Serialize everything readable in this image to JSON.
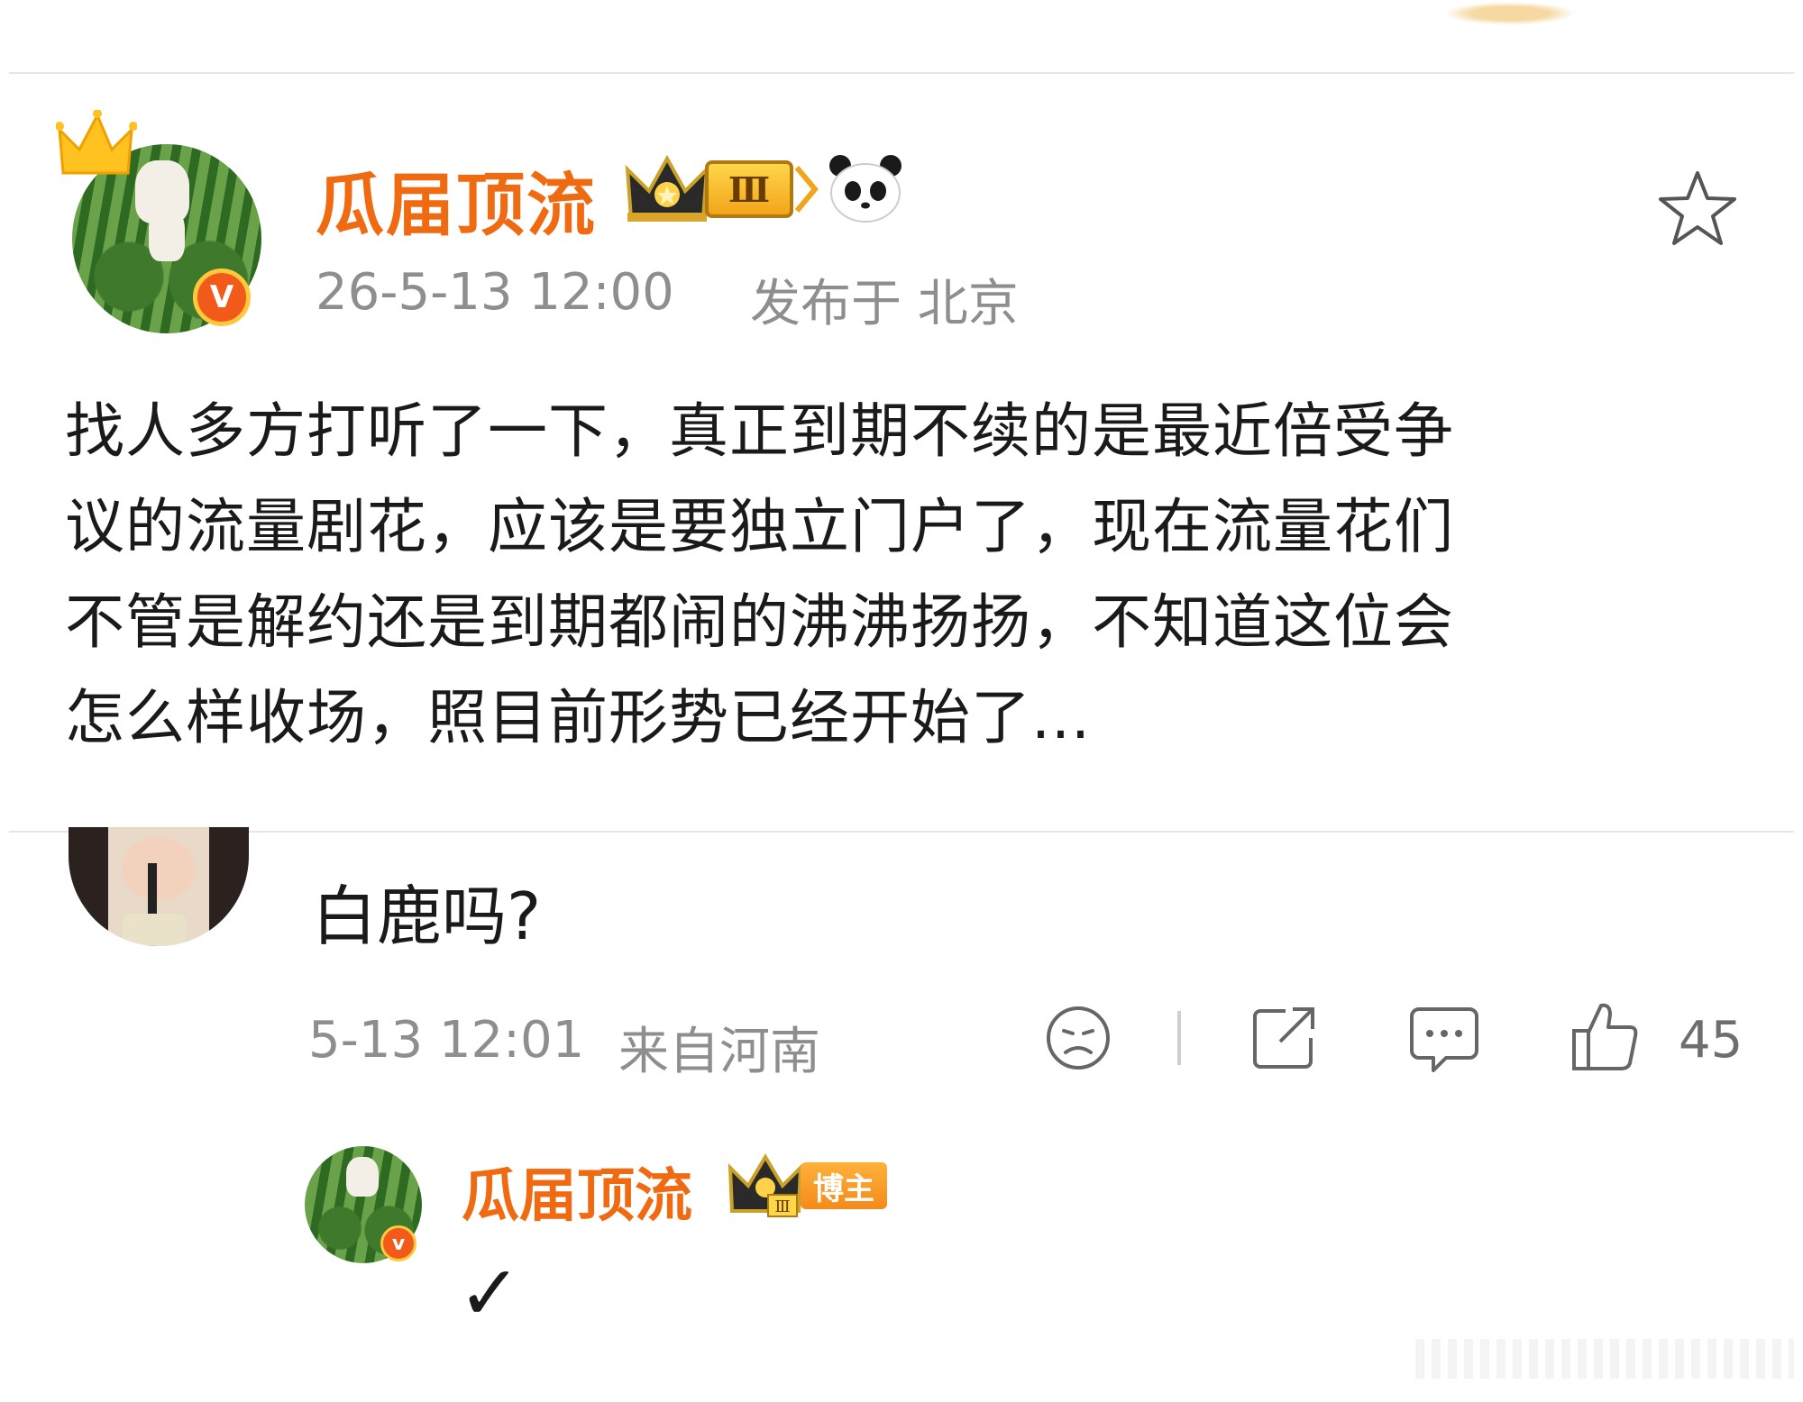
{
  "post": {
    "author": "瓜届顶流",
    "level_label": "Ⅲ",
    "timestamp": "26-5-13 12:00",
    "location": "发布于 北京",
    "text_lines": [
      "找人多方打听了一下，真正到期不续的是最近倍受争",
      "议的流量剧花，应该是要独立门户了，现在流量花们",
      "不管是解约还是到期都闹的沸沸扬扬，不知道这位会",
      "怎么样收场，照目前形势已经开始了..."
    ],
    "verified_badge": "V"
  },
  "comment": {
    "text": "白鹿吗?",
    "timestamp": "5-13 12:01",
    "location": "来自河南",
    "like_count": "45"
  },
  "reply": {
    "author": "瓜届顶流",
    "level_label": "Ⅲ",
    "role_tag": "博主",
    "text": "✓",
    "verified_badge": "v"
  },
  "icons": {
    "star": "star-icon",
    "panda": "panda-icon",
    "crown": "crown-icon",
    "dislike": "sad-face-icon",
    "share": "share-icon",
    "reply": "comment-icon",
    "like": "thumbs-up-icon"
  },
  "colors": {
    "accent_name": "#f06a12",
    "meta_gray": "#8e8e8e",
    "verified": "#f25a1a"
  }
}
